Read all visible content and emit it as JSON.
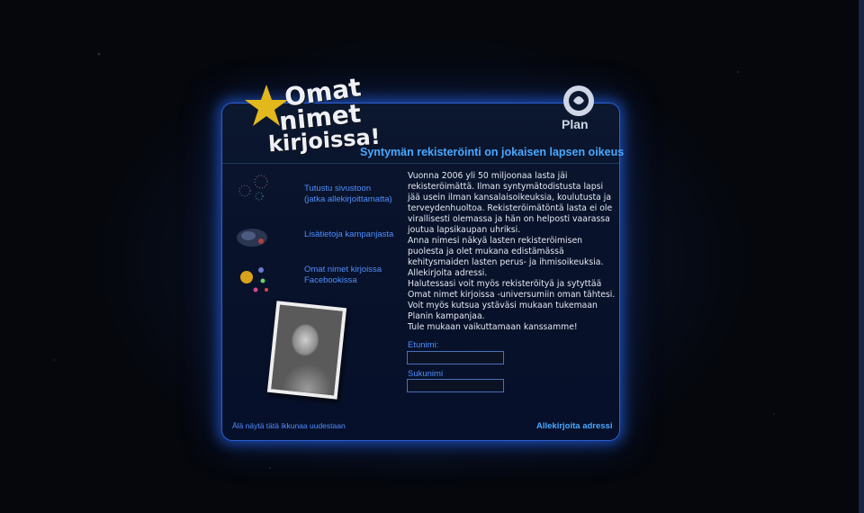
{
  "logo": {
    "line1": "Omat",
    "line2": "nimet",
    "line3": "kirjoissa!"
  },
  "partner_logo": {
    "text": "Plan"
  },
  "headline": "Syntymän rekisteröinti on jokaisen lapsen oikeus",
  "nav": [
    {
      "label_line1": "Tutustu sivustoon",
      "label_line2": "(jatka allekirjoittamatta)",
      "icon": "fireworks-icon"
    },
    {
      "label_line1": "Lisätietoja kampanjasta",
      "label_line2": "",
      "icon": "nebula-icon"
    },
    {
      "label_line1": "Omat nimet kirjoissa",
      "label_line2": "Facebookissa",
      "icon": "colored-dots-icon"
    }
  ],
  "body": {
    "p1": "Vuonna 2006 yli 50 miljoonaa lasta jäi rekisteröimättä. Ilman syntymätodistusta lapsi jää usein ilman kansalaisoikeuksia, koulutusta ja terveydenhuoltoa. Rekisteröimätöntä lasta ei ole virallisesti olemassa ja hän on helposti vaarassa joutua lapsikaupan uhriksi.",
    "p2": "Anna nimesi näkyä lasten rekisteröimisen puolesta ja olet mukana edistämässä kehitysmaiden lasten perus- ja ihmisoikeuksia. Allekirjoita adressi.",
    "p3": "Halutessasi voit myös rekisteröityä ja sytyttää Omat nimet kirjoissa -universumiin oman tähtesi. Voit myös kutsua ystäväsi mukaan tukemaan Planin kampanjaa.",
    "p4": "Tule mukaan vaikuttamaan kanssamme!"
  },
  "form": {
    "first_name_label": "Etunimi:",
    "first_name_value": "",
    "last_name_label": "Sukunimi",
    "last_name_value": ""
  },
  "footer": {
    "hide_link": "Älä näytä tätä ikkunaa uudestaan",
    "submit_label": "Allekirjoita adressi"
  },
  "colors": {
    "accent": "#4f8fff",
    "headline": "#4aa8ff",
    "star": "#e3b81c",
    "glow": "#2b6bff"
  }
}
